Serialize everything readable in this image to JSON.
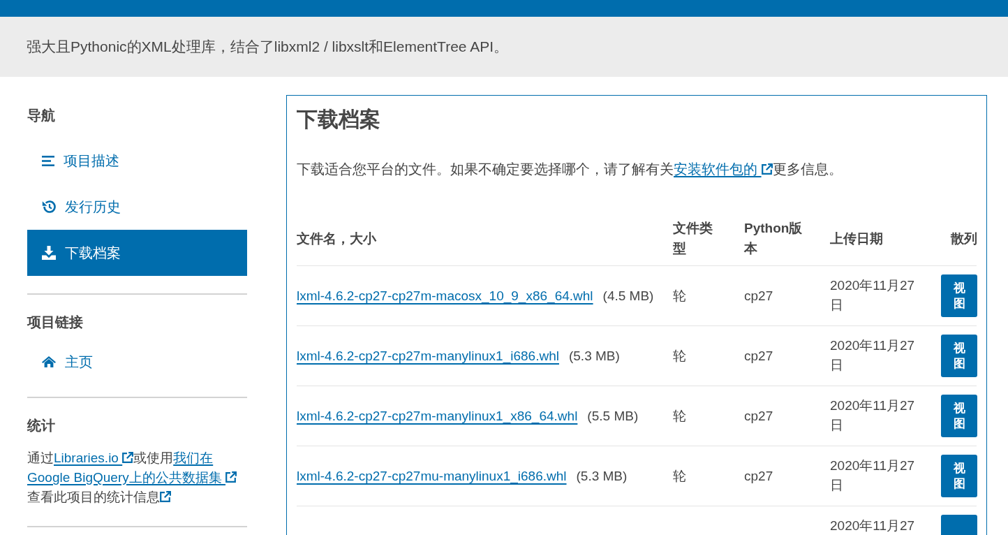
{
  "header": {
    "summary": "强大且Pythonic的XML处理库，结合了libxml2 / libxslt和ElementTree API。"
  },
  "sidebar": {
    "navigation": {
      "title": "导航",
      "items": [
        {
          "label": "项目描述",
          "selected": false
        },
        {
          "label": "发行历史",
          "selected": false
        },
        {
          "label": "下载档案",
          "selected": true
        }
      ]
    },
    "project_links": {
      "title": "项目链接",
      "items": [
        {
          "label": "主页"
        }
      ]
    },
    "statistics": {
      "title": "统计",
      "parts": [
        {
          "kind": "text",
          "text": "通过"
        },
        {
          "kind": "external_link",
          "text": "Libraries.io"
        },
        {
          "kind": "text",
          "text": "或使用"
        },
        {
          "kind": "link",
          "text": "我们在"
        },
        {
          "kind": "external_link",
          "text": "Google BigQuery上的公共数据集"
        },
        {
          "kind": "text",
          "text": "查看此项目的统计信息"
        },
        {
          "kind": "icon_link"
        }
      ]
    }
  },
  "main": {
    "title": "下载档案",
    "intro": [
      {
        "kind": "text",
        "text": "下载适合您平台的文件。如果不确定要选择哪个，请了解有关"
      },
      {
        "kind": "external_link",
        "text": "安装软件包的"
      },
      {
        "kind": "text",
        "text": "更多信息。"
      }
    ],
    "table": {
      "columns": [
        "文件名，大小",
        "文件类型",
        "Python版本",
        "上传日期",
        "散列"
      ],
      "rows": [
        {
          "file": "lxml-4.6.2-cp27-cp27m-macosx_10_9_x86_64.whl",
          "size": "(4.5 MB)",
          "type": "轮",
          "python": "cp27",
          "date": "2020年11月27日",
          "button": "视图"
        },
        {
          "file": "lxml-4.6.2-cp27-cp27m-manylinux1_i686.whl",
          "size": "(5.3 MB)",
          "type": "轮",
          "python": "cp27",
          "date": "2020年11月27日",
          "button": "视图"
        },
        {
          "file": "lxml-4.6.2-cp27-cp27m-manylinux1_x86_64.whl",
          "size": "(5.5 MB)",
          "type": "轮",
          "python": "cp27",
          "date": "2020年11月27日",
          "button": "视图"
        },
        {
          "file": "lxml-4.6.2-cp27-cp27mu-manylinux1_i686.whl",
          "size": "(5.3 MB)",
          "type": "轮",
          "python": "cp27",
          "date": "2020年11月27日",
          "button": "视图"
        },
        {
          "date": "2020年11月27"
        }
      ]
    }
  }
}
